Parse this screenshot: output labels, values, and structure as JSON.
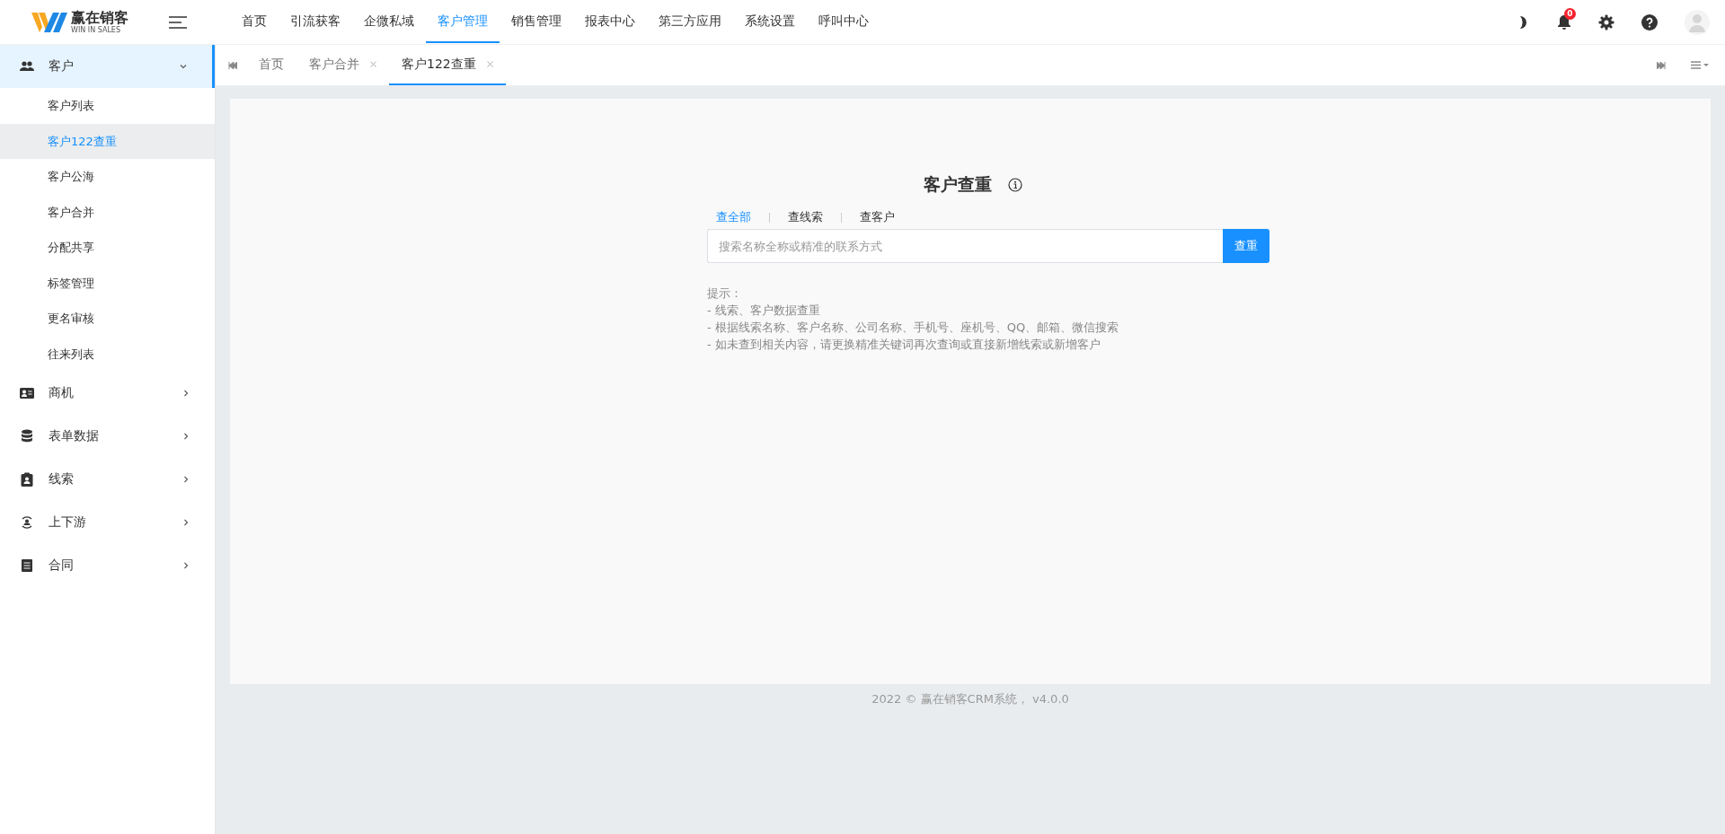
{
  "header": {
    "logo": {
      "brand": "赢在销客",
      "tagline": "WIN IN SALES"
    },
    "nav": [
      {
        "label": "首页",
        "selected": false
      },
      {
        "label": "引流获客",
        "selected": false
      },
      {
        "label": "企微私域",
        "selected": false
      },
      {
        "label": "客户管理",
        "selected": true
      },
      {
        "label": "销售管理",
        "selected": false
      },
      {
        "label": "报表中心",
        "selected": false
      },
      {
        "label": "第三方应用",
        "selected": false
      },
      {
        "label": "系统设置",
        "selected": false
      },
      {
        "label": "呼叫中心",
        "selected": false
      }
    ],
    "notification_count": "0"
  },
  "sidebar": {
    "items": [
      {
        "label": "客户",
        "expanded": true,
        "selected": true,
        "children": [
          {
            "label": "客户列表",
            "selected": false
          },
          {
            "label": "客户122查重",
            "selected": true
          },
          {
            "label": "客户公海",
            "selected": false
          },
          {
            "label": "客户合并",
            "selected": false
          },
          {
            "label": "分配共享",
            "selected": false
          },
          {
            "label": "标签管理",
            "selected": false
          },
          {
            "label": "更名审核",
            "selected": false
          },
          {
            "label": "往来列表",
            "selected": false
          }
        ]
      },
      {
        "label": "商机",
        "expanded": false,
        "selected": false
      },
      {
        "label": "表单数据",
        "expanded": false,
        "selected": false
      },
      {
        "label": "线索",
        "expanded": false,
        "selected": false
      },
      {
        "label": "上下游",
        "expanded": false,
        "selected": false
      },
      {
        "label": "合同",
        "expanded": false,
        "selected": false
      }
    ]
  },
  "tabs": [
    {
      "label": "首页",
      "selected": false,
      "closable": false
    },
    {
      "label": "客户合并",
      "selected": false,
      "closable": true
    },
    {
      "label": "客户122查重",
      "selected": true,
      "closable": true
    }
  ],
  "search": {
    "title": "客户查重",
    "scopes": [
      {
        "label": "查全部",
        "selected": true
      },
      {
        "label": "查线索",
        "selected": false
      },
      {
        "label": "查客户",
        "selected": false
      }
    ],
    "placeholder": "搜索名称全称或精准的联系方式",
    "button": "查重",
    "hints": [
      "提示：",
      "- 线索、客户数据查重",
      "- 根据线索名称、客户名称、公司名称、手机号、座机号、QQ、邮箱、微信搜索",
      "- 如未查到相关内容，请更换精准关键词再次查询或直接新增线索或新增客户"
    ]
  },
  "footer": "2022 © 赢在销客CRM系统， v4.0.0"
}
